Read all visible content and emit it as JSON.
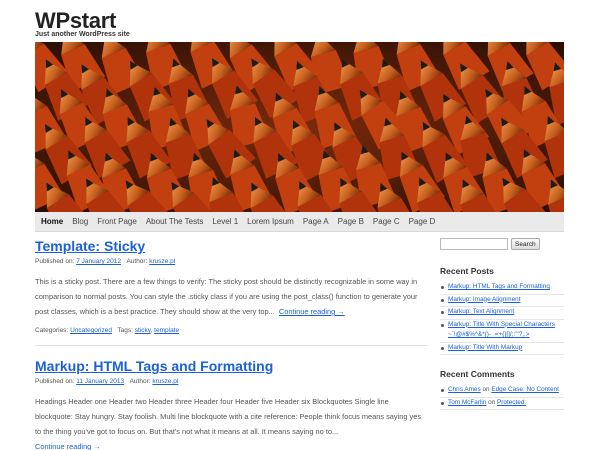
{
  "site": {
    "title": "WPstart",
    "description": "Just another WordPress site"
  },
  "nav": {
    "items": [
      "Home",
      "Blog",
      "Front Page",
      "About The Tests",
      "Level 1",
      "Lorem Ipsum",
      "Page A",
      "Page B",
      "Page C",
      "Page D"
    ],
    "active": "Home"
  },
  "posts": [
    {
      "title": "Template: Sticky",
      "published_label": "Published on:",
      "date": "7 January 2012",
      "author_label": "Author:",
      "author": "krusze.pl",
      "excerpt": "This is a sticky post. There are a few things to verify: The sticky post should be distinctly recognizable in some way in comparison to normal posts. You can style the .sticky class if you are using the post_class() function to generate your post classes, which is a best practice. They should show at the very top...",
      "continue_label": "Continue reading →",
      "categories_label": "Categories:",
      "categories": [
        "Uncategorized"
      ],
      "tags_label": "Tags:",
      "tags": [
        "sticky",
        "template"
      ]
    },
    {
      "title": "Markup: HTML Tags and Formatting",
      "published_label": "Published on:",
      "date": "11 January 2013",
      "author_label": "Author:",
      "author": "krusze.pl",
      "excerpt": "Headings Header one Header two Header three Header four Header five Header six Blockquotes Single line blockquote: Stay hungry. Stay foolish. Multi line blockquote with a cite reference: People think focus means saying yes to the thing you've got to focus on. But that's not what it means at all. It means saying no to...",
      "continue_label": "Continue reading →"
    }
  ],
  "sidebar": {
    "search": {
      "placeholder": "",
      "button_label": "Search"
    },
    "recent_posts": {
      "title": "Recent Posts",
      "items": [
        "Markup: HTML Tags and Formatting",
        "Markup: Image Alignment",
        "Markup: Text Alignment",
        "Markup: Title With Special Characters ~`!@#$%^&*()-_=+{}[]/;:'\"?,.>",
        "Markup: Title With Markup"
      ]
    },
    "recent_comments": {
      "title": "Recent Comments",
      "items": [
        {
          "author": "Chris Ames",
          "on": "on",
          "post": "Edge Case: No Content"
        },
        {
          "author": "Tom McFarlin",
          "on": "on",
          "post": "Protected:"
        }
      ]
    }
  },
  "colors": {
    "link": "#1b61d6",
    "nav_bg": "#eaeaea"
  }
}
